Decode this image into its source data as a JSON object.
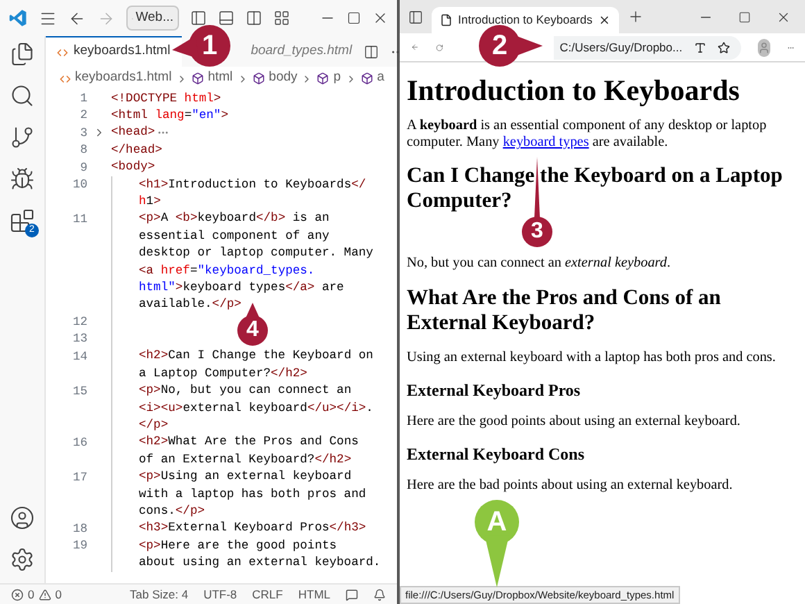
{
  "editor": {
    "search": {
      "value": "Web..."
    },
    "tabs": [
      {
        "label": "keyboards1.html",
        "selected": true,
        "preview": false
      },
      {
        "label": "board_types.html",
        "selected": false,
        "preview": true
      }
    ],
    "breadcrumbs": [
      {
        "label": "keyboards1.html",
        "kind": "file"
      },
      {
        "label": "html",
        "kind": "element"
      },
      {
        "label": "body",
        "kind": "element"
      },
      {
        "label": "p",
        "kind": "element"
      },
      {
        "label": "a",
        "kind": "element"
      }
    ],
    "extensions_badge": "2",
    "lines": [
      {
        "number": "1",
        "kind": "code",
        "rows": [
          "<!DOCTYPE html>"
        ]
      },
      {
        "number": "2",
        "kind": "code",
        "rows": [
          "<html lang=\"en\">"
        ]
      },
      {
        "number": "3",
        "kind": "folded",
        "rows": [
          "<head>"
        ]
      },
      {
        "number": "8",
        "kind": "code",
        "rows": [
          "</head>"
        ]
      },
      {
        "number": "9",
        "kind": "code",
        "rows": [
          "<body>"
        ],
        "children": [
          {
            "number": "10",
            "kind": "code",
            "rows": [
              "<h1>Introduction to Keyboards</",
              "h1>"
            ]
          },
          {
            "number": "11",
            "kind": "code",
            "rows": [
              "<p>A <b>keyboard</b> is an",
              "essential component of any",
              "desktop or laptop computer. Many",
              "<a href=\"keyboard_types.",
              "html\">keyboard types</a> are",
              "available.</p>"
            ]
          },
          {
            "number": "12",
            "kind": "code",
            "rows": [
              ""
            ]
          },
          {
            "number": "13",
            "kind": "code",
            "rows": [
              ""
            ]
          },
          {
            "number": "14",
            "kind": "code",
            "rows": [
              "<h2>Can I Change the Keyboard on",
              "a Laptop Computer?</h2>"
            ]
          },
          {
            "number": "15",
            "kind": "code",
            "rows": [
              "<p>No, but you can connect an",
              "<i><u>external keyboard</u></i>.",
              "</p>"
            ]
          },
          {
            "number": "16",
            "kind": "code",
            "rows": [
              "<h2>What Are the Pros and Cons",
              "of an External Keyboard?</h2>"
            ]
          },
          {
            "number": "17",
            "kind": "code",
            "rows": [
              "<p>Using an external keyboard",
              "with a laptop has both pros and",
              "cons.</p>"
            ]
          },
          {
            "number": "18",
            "kind": "code",
            "rows": [
              "<h3>External Keyboard Pros</h3>"
            ]
          },
          {
            "number": "19",
            "kind": "code",
            "rows": [
              "<p>Here are the good points",
              "about using an external keyboard."
            ]
          }
        ]
      }
    ],
    "status": {
      "errors": "0",
      "warnings": "0",
      "items": [
        "Tab Size: 4",
        "UTF-8",
        "CRLF",
        "HTML"
      ]
    }
  },
  "browser": {
    "tabs": [
      {
        "label": "Introduction to Keyboards",
        "selected": true
      }
    ],
    "address": "C:/Users/Guy/Dropbo...",
    "page": [
      {
        "kind": "h1",
        "text": "Introduction to Keyboards"
      },
      {
        "kind": "p_link",
        "before": "A **keyboard** is an essential component of any desktop or laptop computer. Many",
        "link": "keyboard types",
        "after": "are available."
      },
      {
        "kind": "h2",
        "text": "Can I Change the Keyboard on a Laptop Computer?"
      },
      {
        "kind": "p",
        "text": "No, but you can connect an *external keyboard*."
      },
      {
        "kind": "h2",
        "text": "What Are the Pros and Cons of an External Keyboard?"
      },
      {
        "kind": "p",
        "text": "Using an external keyboard with a laptop has both pros and cons."
      },
      {
        "kind": "h3",
        "text": "External Keyboard Pros"
      },
      {
        "kind": "p",
        "text": "Here are the good points about using an external keyboard."
      },
      {
        "kind": "h3",
        "text": "External Keyboard Cons"
      },
      {
        "kind": "p",
        "text": "Here are the bad points about using an external keyboard."
      }
    ],
    "status_url": "file:///C:/Users/Guy/Dropbox/Website/keyboard_types.html"
  },
  "callouts": [
    {
      "label": "1",
      "kind": "step"
    },
    {
      "label": "2",
      "kind": "step"
    },
    {
      "label": "3",
      "kind": "step"
    },
    {
      "label": "4",
      "kind": "step"
    },
    {
      "label": "A",
      "kind": "pin"
    }
  ]
}
